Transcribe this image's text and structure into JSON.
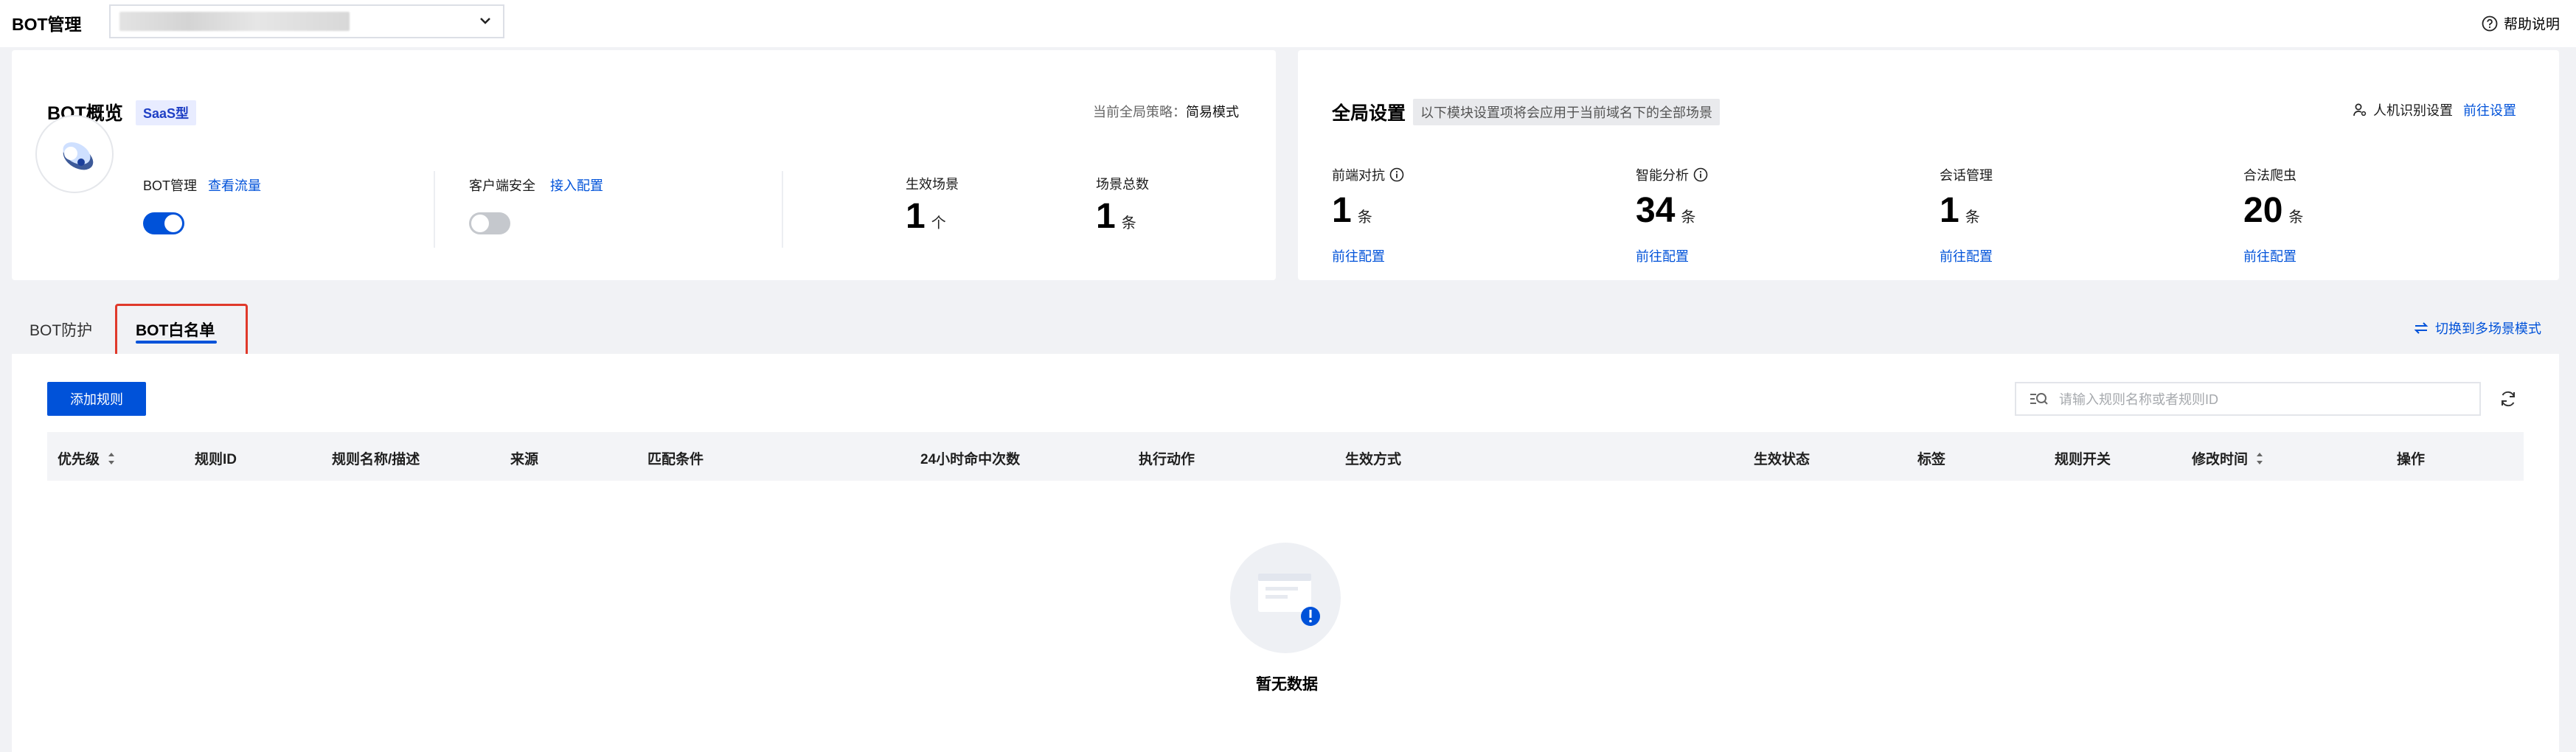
{
  "header": {
    "title": "BOT管理",
    "domain_value": "",
    "help_label": "帮助说明"
  },
  "overview": {
    "title": "BOT概览",
    "edition_badge": "SaaS型",
    "policy_label": "当前全局策略：",
    "policy_value": "简易模式",
    "bot_mgmt": {
      "label": "BOT管理",
      "link": "查看流量",
      "enabled": true
    },
    "client_security": {
      "label": "客户端安全",
      "link": "接入配置",
      "enabled": false
    },
    "active_scenes": {
      "label": "生效场景",
      "value": "1",
      "unit": "个"
    },
    "total_scenes": {
      "label": "场景总数",
      "value": "1",
      "unit": "条"
    }
  },
  "global_settings": {
    "title": "全局设置",
    "description": "以下模块设置项将会应用于当前域名下的全部场景",
    "captcha_label": "人机识别设置",
    "captcha_link": "前往设置",
    "stats": [
      {
        "label": "前端对抗",
        "value": "1",
        "unit": "条",
        "link": "前往配置",
        "info": true
      },
      {
        "label": "智能分析",
        "value": "34",
        "unit": "条",
        "link": "前往配置",
        "info": true
      },
      {
        "label": "会话管理",
        "value": "1",
        "unit": "条",
        "link": "前往配置",
        "info": false
      },
      {
        "label": "合法爬虫",
        "value": "20",
        "unit": "条",
        "link": "前往配置",
        "info": false
      }
    ]
  },
  "tabs": [
    {
      "label": "BOT防护",
      "active": false
    },
    {
      "label": "BOT白名单",
      "active": true
    }
  ],
  "switch_mode_label": "切换到多场景模式",
  "toolbar": {
    "add_rule_label": "添加规则",
    "search_placeholder": "请输入规则名称或者规则ID"
  },
  "table": {
    "columns": [
      "优先级",
      "规则ID",
      "规则名称/描述",
      "来源",
      "匹配条件",
      "24小时命中次数",
      "执行动作",
      "生效方式",
      "生效状态",
      "标签",
      "规则开关",
      "修改时间",
      "操作"
    ],
    "rows": [],
    "empty_text": "暂无数据"
  },
  "colors": {
    "primary": "#0052d9",
    "highlight": "#e0392b",
    "background": "#f1f2f5"
  }
}
